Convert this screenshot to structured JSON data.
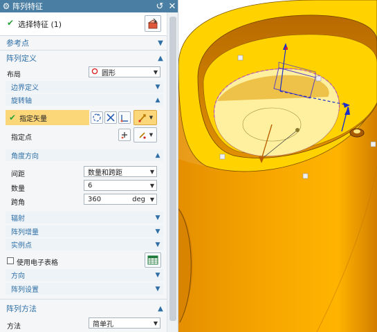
{
  "dialog": {
    "title": "阵列特征",
    "select_feature": "选择特征 (1)",
    "sections": {
      "reference_point": "参考点",
      "pattern_definition": "阵列定义",
      "pattern_method": "阵列方法"
    },
    "layout_label": "布局",
    "layout_value": "圆形",
    "boundary_definition": "边界定义",
    "rotation_axis": "旋转轴",
    "specify_vector": "指定矢量",
    "specify_point": "指定点",
    "angular_direction": "角度方向",
    "spacing_label": "间距",
    "spacing_value": "数量和跨距",
    "count_label": "数量",
    "count_value": "6",
    "span_label": "跨角",
    "span_value": "360",
    "span_unit": "deg",
    "radiate": "辐射",
    "pattern_increment": "阵列增量",
    "instance_points": "实例点",
    "use_spreadsheet": "使用电子表格",
    "direction": "方向",
    "pattern_settings": "阵列设置",
    "method_label": "方法",
    "method_value": "简单孔"
  },
  "colors": {
    "titlebar": "#4a7fa3",
    "section_text": "#2f6fa6",
    "highlight": "#fbd77a",
    "check": "#2aa33a",
    "part_orange": "#f5a100",
    "part_rim": "#ffd200"
  },
  "icons": [
    "gear-icon",
    "reset-icon",
    "close-icon",
    "check-icon",
    "select-feature-icon",
    "vector-dialog-icon",
    "vector-cross-icon",
    "vector-axis-icon",
    "inferred-vector-icon",
    "point-dialog-icon",
    "point-inferred-icon",
    "spreadsheet-icon",
    "chevron-up-icon",
    "chevron-down-icon"
  ]
}
